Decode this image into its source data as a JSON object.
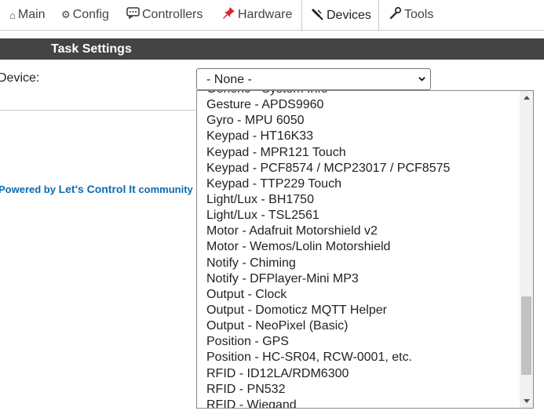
{
  "menu": {
    "tabs": [
      {
        "label": "Main",
        "icon": "home-icon",
        "glyph": "⌂"
      },
      {
        "label": "Config",
        "icon": "gear-icon",
        "glyph": "⚙"
      },
      {
        "label": "Controllers",
        "icon": "chat-icon",
        "glyph": "💬"
      },
      {
        "label": "Hardware",
        "icon": "pushpin-icon",
        "glyph": "📌"
      },
      {
        "label": "Devices",
        "icon": "plug-icon",
        "glyph": "🔌"
      },
      {
        "label": "Tools",
        "icon": "wrench-icon",
        "glyph": "🔧"
      }
    ],
    "active_tab": "Devices"
  },
  "task_settings": {
    "title": "Task Settings",
    "device_label": "Device:",
    "device_select_value": "- None -"
  },
  "footer": {
    "prefix": "Powered by ",
    "link": "Let's Control It",
    "suffix": " community"
  },
  "dropdown": {
    "options": [
      "Generic - System Info",
      "Gesture - APDS9960",
      "Gyro - MPU 6050",
      "Keypad - HT16K33",
      "Keypad - MPR121 Touch",
      "Keypad - PCF8574 / MCP23017 / PCF8575",
      "Keypad - TTP229 Touch",
      "Light/Lux - BH1750",
      "Light/Lux - TSL2561",
      "Motor - Adafruit Motorshield v2",
      "Motor - Wemos/Lolin Motorshield",
      "Notify - Chiming",
      "Notify - DFPlayer-Mini MP3",
      "Output - Clock",
      "Output - Domoticz MQTT Helper",
      "Output - NeoPixel (Basic)",
      "Position - GPS",
      "Position - HC-SR04, RCW-0001, etc.",
      "RFID - ID12LA/RDM6300",
      "RFID - PN532",
      "RFID - Wiegand"
    ]
  },
  "colors": {
    "header_bar": "#444444",
    "footer_link": "#0a6bb3",
    "accent_pin": "#d9262c"
  }
}
